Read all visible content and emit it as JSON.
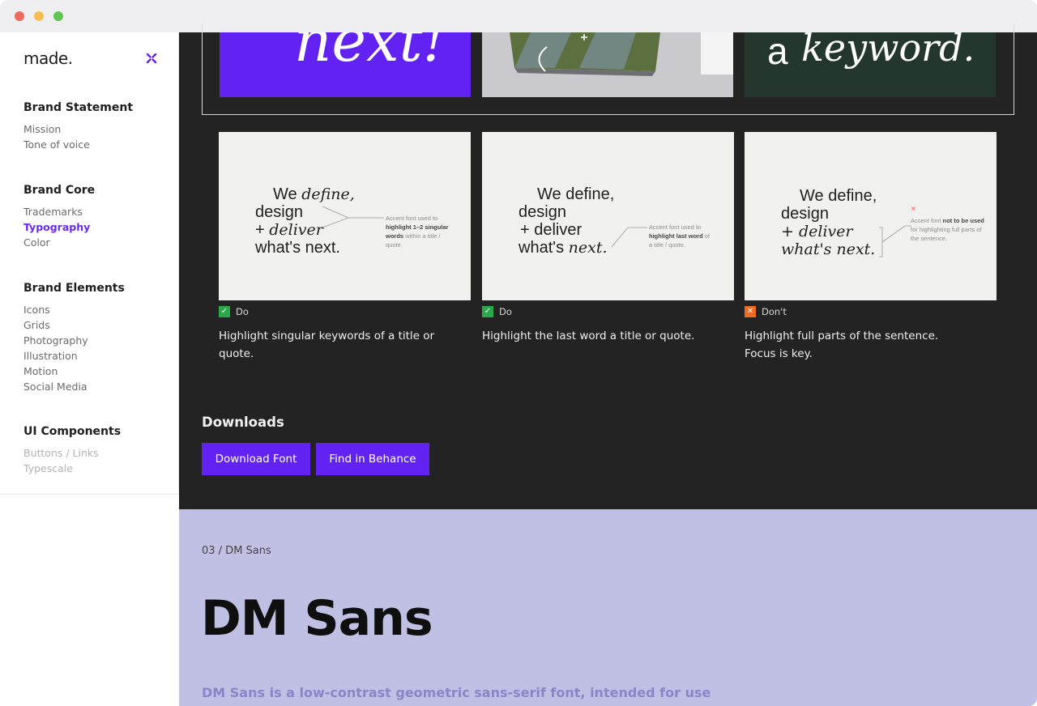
{
  "sidebar": {
    "logo": "made.",
    "groups": [
      {
        "heading": "Brand Statement",
        "items": [
          "Mission",
          "Tone of voice"
        ]
      },
      {
        "heading": "Brand Core",
        "items": [
          "Trademarks",
          "Typography",
          "Color"
        ]
      },
      {
        "heading": "Brand Elements",
        "items": [
          "Icons",
          "Grids",
          "Photography",
          "Illustration",
          "Motion",
          "Social Media"
        ]
      },
      {
        "heading": "UI Components",
        "items": [
          "Buttons / Links",
          "Typescale"
        ]
      }
    ],
    "active_item": "Typography"
  },
  "thumbnails": {
    "t1_text": "next!",
    "t3_text_plain": "a",
    "t3_text_italic": "keyword."
  },
  "cards": [
    {
      "sample": {
        "l1a": "We",
        "l1b": "define,",
        "l2": "design",
        "l3a": "+",
        "l3b": "deliver",
        "l4": "what's next."
      },
      "note": {
        "pre": "Accent font used to",
        "bold": "highlight 1–2 singular words",
        "post": "within a title / quote."
      },
      "status": "Do",
      "description": "Highlight singular keywords of a title or quote."
    },
    {
      "sample": {
        "l1": "We define,",
        "l2": "design",
        "l3": "+ deliver",
        "l4a": "what's",
        "l4b": "next."
      },
      "note": {
        "pre": "Accent font used to",
        "bold": "highlight last word",
        "post": "of a title / quote."
      },
      "status": "Do",
      "description": "Highlight the last word a title or quote."
    },
    {
      "sample": {
        "l1": "We define,",
        "l2": "design",
        "l3": "+ deliver",
        "l4": "what's next."
      },
      "note": {
        "pre": "Accent font",
        "bold": "not to be used",
        "post": "for highlighting full parts of the sentence."
      },
      "status": "Don't",
      "description": "Highlight full parts of the sentence. Focus is key."
    }
  ],
  "downloads": {
    "title": "Downloads",
    "download_font": "Download Font",
    "find_behance": "Find in Behance"
  },
  "section": {
    "breadcrumb": "03 / DM Sans",
    "title": "DM Sans",
    "intro": "DM Sans is a low-contrast geometric sans-serif font, intended for use"
  },
  "colors": {
    "accent": "#6222f2",
    "do": "#2ba94a",
    "dont": "#f06b1d",
    "dark_bg": "#232323",
    "lavender_bg": "#c0bfe4"
  }
}
